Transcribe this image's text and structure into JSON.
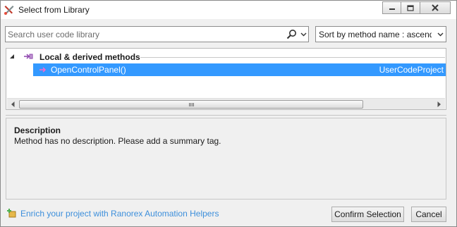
{
  "window": {
    "title": "Select from Library",
    "icon": "ranorex-tools-icon"
  },
  "title_buttons": {
    "minimize_icon": "minimize-icon",
    "maximize_icon": "maximize-icon",
    "close_icon": "close-icon"
  },
  "search": {
    "placeholder": "Search user code library",
    "value": "",
    "search_icon": "magnifier-icon",
    "dropdown_icon": "chevron-down-icon"
  },
  "sort": {
    "selected": "Sort by method name : ascending"
  },
  "tree": {
    "groups": [
      {
        "label": "Local & derived methods",
        "expanded": true,
        "items": [
          {
            "name": "OpenControlPanel()",
            "project": "UserCodeProject",
            "selected": true
          }
        ]
      }
    ]
  },
  "description": {
    "title": "Description",
    "text": "Method has no description. Please add a summary tag."
  },
  "footer": {
    "link_text": "Enrich your project with Ranorex Automation Helpers",
    "confirm_label": "Confirm Selection",
    "cancel_label": "Cancel"
  },
  "colors": {
    "selection": "#3399ff",
    "link": "#3d8fdb",
    "window_bg": "#f0f0f0"
  }
}
